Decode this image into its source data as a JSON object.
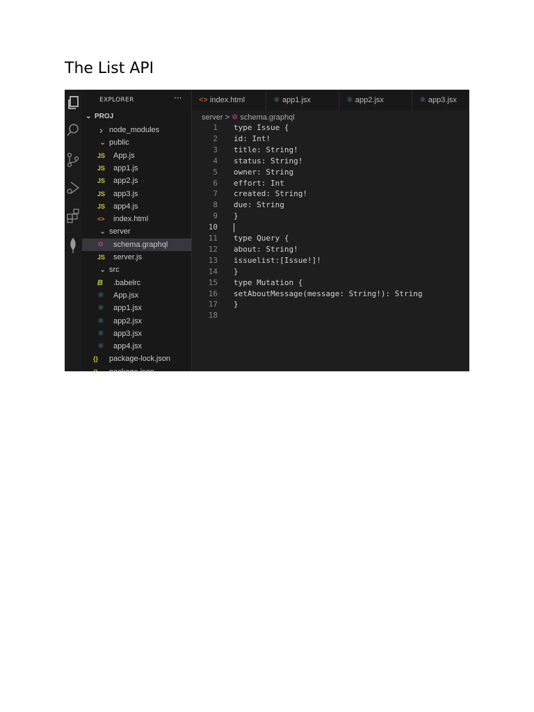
{
  "document": {
    "title": "The List API"
  },
  "vscode": {
    "activity_bar": [
      "files-icon",
      "search-icon",
      "source-control-icon",
      "run-debug-icon",
      "extensions-icon",
      "mongodb-leaf-icon"
    ],
    "explorer": {
      "header": "EXPLORER",
      "more": "···",
      "root": "PROJ",
      "items": [
        {
          "label": "node_modules",
          "type": "folder",
          "expanded": false,
          "depth": 1
        },
        {
          "label": "public",
          "type": "folder",
          "expanded": true,
          "depth": 1
        },
        {
          "label": "App.js",
          "type": "js",
          "depth": 2
        },
        {
          "label": "app1.js",
          "type": "js",
          "depth": 2
        },
        {
          "label": "app2.js",
          "type": "js",
          "depth": 2
        },
        {
          "label": "app3.js",
          "type": "js",
          "depth": 2
        },
        {
          "label": "app4.js",
          "type": "js",
          "depth": 2
        },
        {
          "label": "index.html",
          "type": "html",
          "depth": 2
        },
        {
          "label": "server",
          "type": "folder",
          "expanded": true,
          "depth": 1
        },
        {
          "label": "schema.graphql",
          "type": "graphql",
          "depth": 2,
          "selected": true
        },
        {
          "label": "server.js",
          "type": "js",
          "depth": 2
        },
        {
          "label": "src",
          "type": "folder",
          "expanded": true,
          "depth": 1
        },
        {
          "label": ".babelrc",
          "type": "babel",
          "depth": 2
        },
        {
          "label": "App.jsx",
          "type": "react",
          "depth": 2
        },
        {
          "label": "app1.jsx",
          "type": "react",
          "depth": 2
        },
        {
          "label": "app2.jsx",
          "type": "react",
          "depth": 2
        },
        {
          "label": "app3.jsx",
          "type": "react",
          "depth": 2
        },
        {
          "label": "app4.jsx",
          "type": "react",
          "depth": 2
        },
        {
          "label": "package-lock.json",
          "type": "json",
          "depth": 1
        },
        {
          "label": "package.json",
          "type": "json",
          "depth": 1
        }
      ]
    },
    "tabs": [
      {
        "label": "index.html",
        "type": "html"
      },
      {
        "label": "app1.jsx",
        "type": "react"
      },
      {
        "label": "app2.jsx",
        "type": "react"
      },
      {
        "label": "app3.jsx",
        "type": "react"
      }
    ],
    "breadcrumb": {
      "folder": "server",
      "separator": ">",
      "file": "schema.graphql"
    },
    "current_line": 10,
    "code_lines": [
      "type Issue {",
      "id: Int!",
      "title: String!",
      "status: String!",
      "owner: String",
      "effort: Int",
      "created: String!",
      "due: String",
      "}",
      "",
      "type Query {",
      "about: String!",
      "issuelist:[Issue!]!",
      "}",
      "type Mutation {",
      "setAboutMessage(message: String!): String",
      "}",
      ""
    ],
    "colors": {
      "js": "#cbcb41",
      "html": "#e37933",
      "graphql": "#e535ab",
      "react": "#519aba",
      "babel": "#c5c52f",
      "json": "#cbcb41",
      "editor_bg": "#1e1e1e",
      "sidebar_bg": "#181818"
    }
  }
}
